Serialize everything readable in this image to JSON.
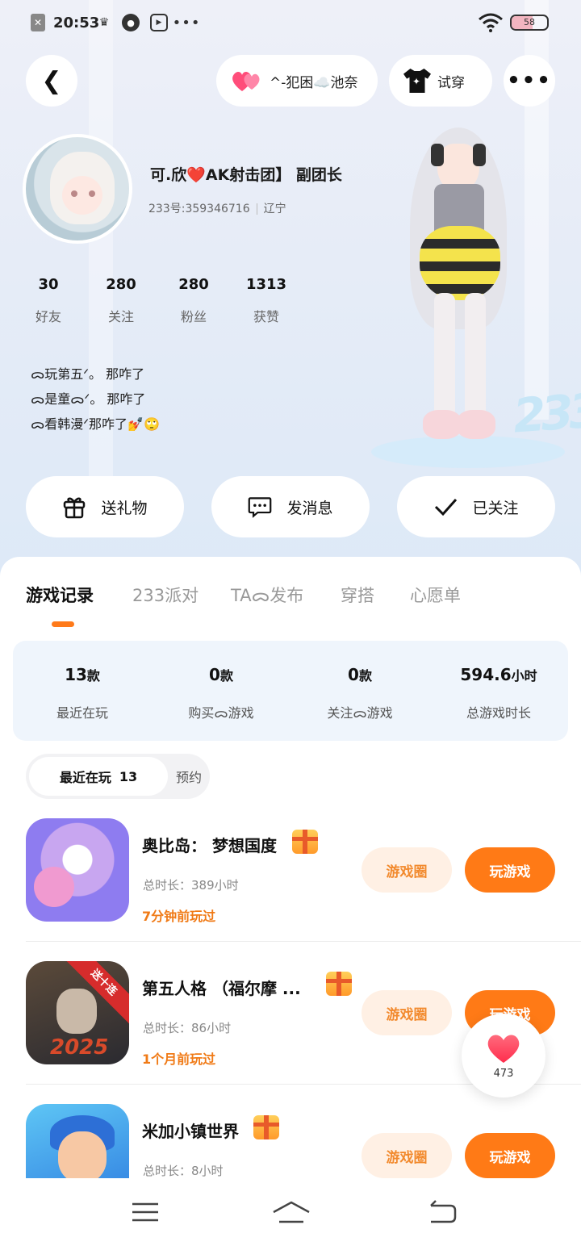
{
  "status": {
    "time": "20:53",
    "battery": "58",
    "battery_level": 0.58,
    "icons": [
      "close-app-icon",
      "crown-icon",
      "app-icon",
      "play-icon",
      "more-dots-icon",
      "wifi-icon",
      "battery-icon"
    ]
  },
  "header": {
    "club_label": "^-犯困☁️池奈",
    "try_label": "试穿"
  },
  "profile": {
    "nickname": "可.欣",
    "nickname_tag": "AK射击团】 副团长",
    "uid": "233号:359346716",
    "region": "辽宁",
    "stats": [
      {
        "num": "30",
        "label": "好友"
      },
      {
        "num": "280",
        "label": "关注"
      },
      {
        "num": "280",
        "label": "粉丝"
      },
      {
        "num": "1313",
        "label": "获赞"
      }
    ],
    "bio": [
      "ᯅ玩第五ᐟ。 那咋了",
      "ᯅ是童ᯅᐟ。 那咋了",
      "ᯅ看韩漫ᐟ那咋了💅🙄"
    ]
  },
  "actions": {
    "gift": "送礼物",
    "message": "发消息",
    "follow": "已关注"
  },
  "tabs": [
    "游戏记录",
    "233派对",
    "TAᯅ发布",
    "穿搭",
    "心愿单"
  ],
  "summary": [
    {
      "value": "13",
      "unit": "款",
      "label": "最近在玩"
    },
    {
      "value": "0",
      "unit": "款",
      "label": "购买ᯅ游戏"
    },
    {
      "value": "0",
      "unit": "款",
      "label": "关注ᯅ游戏"
    },
    {
      "value": "594.6",
      "unit": "小时",
      "label": "总游戏时长"
    }
  ],
  "filter": {
    "recent_label": "最近在玩",
    "recent_count": "13",
    "reserve_label": "预约"
  },
  "games": [
    {
      "name": "奥比岛： 梦想国度",
      "duration_label": "总时长：",
      "duration": "389小时",
      "last": "7分钟前玩过",
      "circle": "游戏圈",
      "play": "玩游戏"
    },
    {
      "name": "第五人格 （福尔摩 ...",
      "duration_label": "总时长：",
      "duration": "86小时",
      "last": "1个月前玩过",
      "circle": "游戏圈",
      "play": "玩游戏",
      "badge": "送十连",
      "badge_year": "2025"
    },
    {
      "name": "米加小镇世界",
      "duration_label": "总时长：",
      "duration": "8小时",
      "last": "",
      "circle": "游戏圈",
      "play": "玩游戏"
    }
  ],
  "like": {
    "count": "473"
  },
  "colors": {
    "accent": "#ff7a16",
    "accent_soft": "#fff0e4",
    "summary_bg": "#eff5fc"
  }
}
